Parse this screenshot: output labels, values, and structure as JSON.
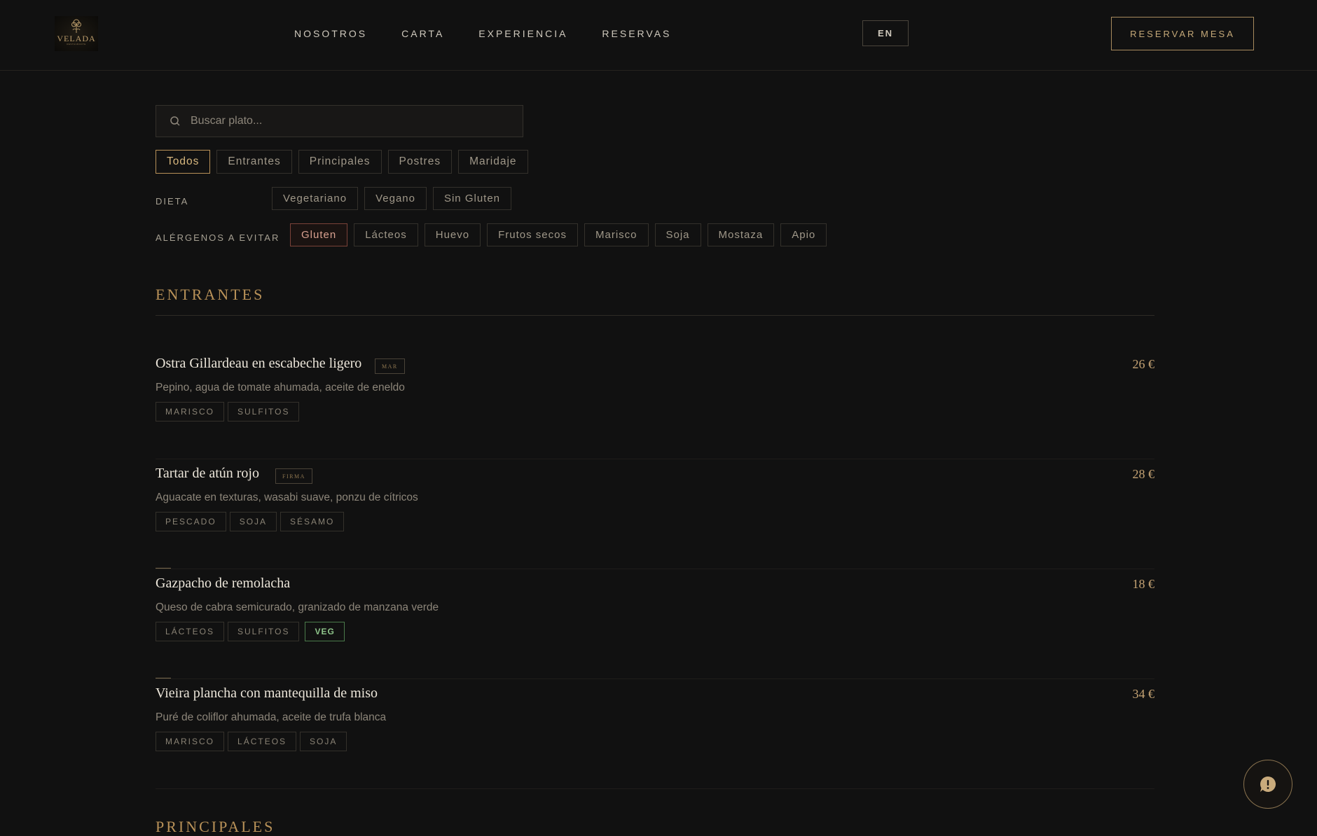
{
  "header": {
    "logo_text": "VELADA",
    "logo_subtext": "RESTAURANTE",
    "nav": [
      "NOSOTROS",
      "CARTA",
      "EXPERIENCIA",
      "RESERVAS"
    ],
    "lang": "EN",
    "reserve": "RESERVAR MESA"
  },
  "search": {
    "placeholder": "Buscar plato..."
  },
  "categories": [
    "Todos",
    "Entrantes",
    "Principales",
    "Postres",
    "Maridaje"
  ],
  "diet": {
    "label": "DIETA",
    "options": [
      "Vegetariano",
      "Vegano",
      "Sin Gluten"
    ]
  },
  "allergens": {
    "label": "ALÉRGENOS A EVITAR",
    "options": [
      "Gluten",
      "Lácteos",
      "Huevo",
      "Frutos secos",
      "Marisco",
      "Soja",
      "Mostaza",
      "Apio"
    ]
  },
  "sections": [
    {
      "title": "ENTRANTES",
      "dishes": [
        {
          "name": "Ostra Gillardeau en escabeche ligero",
          "badge": "MAR",
          "price": "26 €",
          "desc": "Pepino, agua de tomate ahumada, aceite de eneldo",
          "tags": [
            "MARISCO",
            "SULFITOS"
          ],
          "veg": ""
        },
        {
          "name": "Tartar de atún rojo",
          "badge": "FIRMA",
          "price": "28 €",
          "desc": "Aguacate en texturas, wasabi suave, ponzu de cítricos",
          "tags": [
            "PESCADO",
            "SOJA",
            "SÉSAMO"
          ],
          "veg": ""
        },
        {
          "name": "Gazpacho de remolacha",
          "badge": "",
          "price": "18 €",
          "desc": "Queso de cabra semicurado, granizado de manzana verde",
          "tags": [
            "LÁCTEOS",
            "SULFITOS"
          ],
          "veg": "VEG"
        },
        {
          "name": "Vieira plancha con mantequilla de miso",
          "badge": "",
          "price": "34 €",
          "desc": "Puré de coliflor ahumada, aceite de trufa blanca",
          "tags": [
            "MARISCO",
            "LÁCTEOS",
            "SOJA"
          ],
          "veg": ""
        }
      ]
    },
    {
      "title": "PRINCIPALES",
      "dishes": []
    }
  ]
}
